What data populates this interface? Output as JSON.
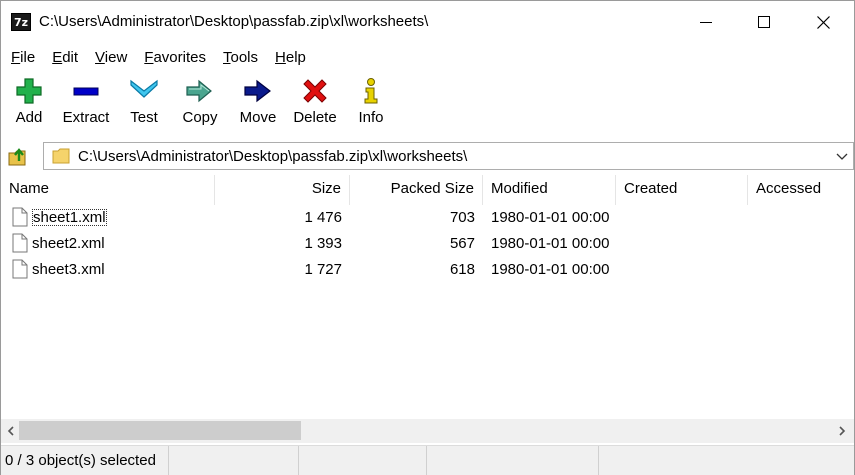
{
  "window": {
    "title": "C:\\Users\\Administrator\\Desktop\\passfab.zip\\xl\\worksheets\\",
    "app_icon": "7z"
  },
  "menu": [
    {
      "label": "File"
    },
    {
      "label": "Edit"
    },
    {
      "label": "View"
    },
    {
      "label": "Favorites"
    },
    {
      "label": "Tools"
    },
    {
      "label": "Help"
    }
  ],
  "toolbar": {
    "add": "Add",
    "extract": "Extract",
    "test": "Test",
    "copy": "Copy",
    "move": "Move",
    "delete": "Delete",
    "info": "Info"
  },
  "address": {
    "path": "C:\\Users\\Administrator\\Desktop\\passfab.zip\\xl\\worksheets\\"
  },
  "columns": {
    "name": "Name",
    "size": "Size",
    "packed": "Packed Size",
    "modified": "Modified",
    "created": "Created",
    "accessed": "Accessed"
  },
  "files": [
    {
      "name": "sheet1.xml",
      "size": "1 476",
      "packed": "703",
      "modified": "1980-01-01 00:00"
    },
    {
      "name": "sheet2.xml",
      "size": "1 393",
      "packed": "567",
      "modified": "1980-01-01 00:00"
    },
    {
      "name": "sheet3.xml",
      "size": "1 727",
      "packed": "618",
      "modified": "1980-01-01 00:00"
    }
  ],
  "status": {
    "selection": "0 / 3 object(s) selected"
  },
  "colors": {
    "add_green": "#22b14c",
    "extract_blue": "#0000c8",
    "test_cyan": "#00a2e8",
    "copy_teal": "#2e8b7a",
    "move_navy": "#0a1a8c",
    "delete_red": "#e01010",
    "info_yellow": "#d4c000"
  }
}
